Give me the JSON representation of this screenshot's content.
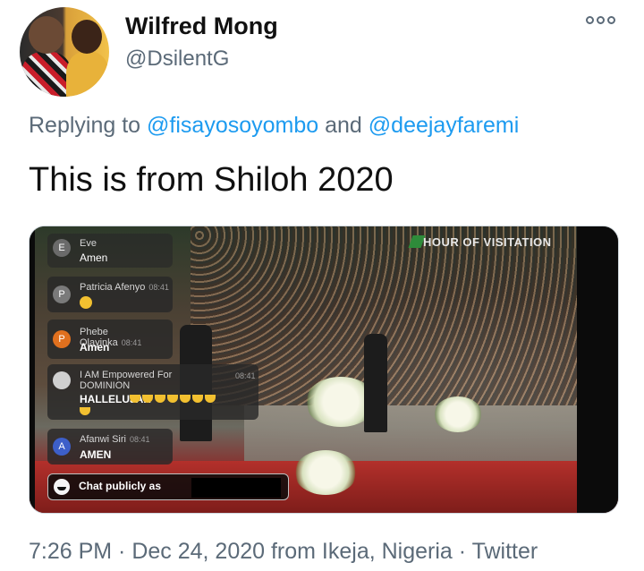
{
  "tweet": {
    "display_name": "Wilfred Mong",
    "handle": "@DsilentG",
    "replying_to_prefix": "Replying to ",
    "mention1": "@fisayosoyombo",
    "and": " and ",
    "mention2": "@deejayfaremi",
    "text": "This is from Shiloh 2020",
    "meta": "7:26 PM · Dec 24, 2020 from Ikeja, Nigeria · Twitter",
    "more_icon": "more-options-icon"
  },
  "media": {
    "watermark": "HOUR OF VISITATION",
    "chat": {
      "messages": [
        {
          "avatar": "E",
          "avatar_color": "#6a6a6a",
          "name": "Eve",
          "time": "",
          "text": "Amen"
        },
        {
          "avatar": "P",
          "avatar_color": "#7a7a7a",
          "name": "Patricia Afenyo",
          "time": "08:41",
          "text": ""
        },
        {
          "avatar": "P",
          "avatar_color": "#e0701e",
          "name": "Phebe Olayinka",
          "time": "08:41",
          "text": "Amen"
        },
        {
          "avatar": "",
          "avatar_color": "#d0d0d0",
          "name": "I AM Empowered For DOMINION",
          "time": "08:41",
          "text": "HALLELUJAH"
        },
        {
          "avatar": "A",
          "avatar_color": "#3d5fc9",
          "name": "Afanwi Siri",
          "time": "08:41",
          "text": "AMEN"
        }
      ],
      "input_label": "Chat publicly as"
    }
  }
}
